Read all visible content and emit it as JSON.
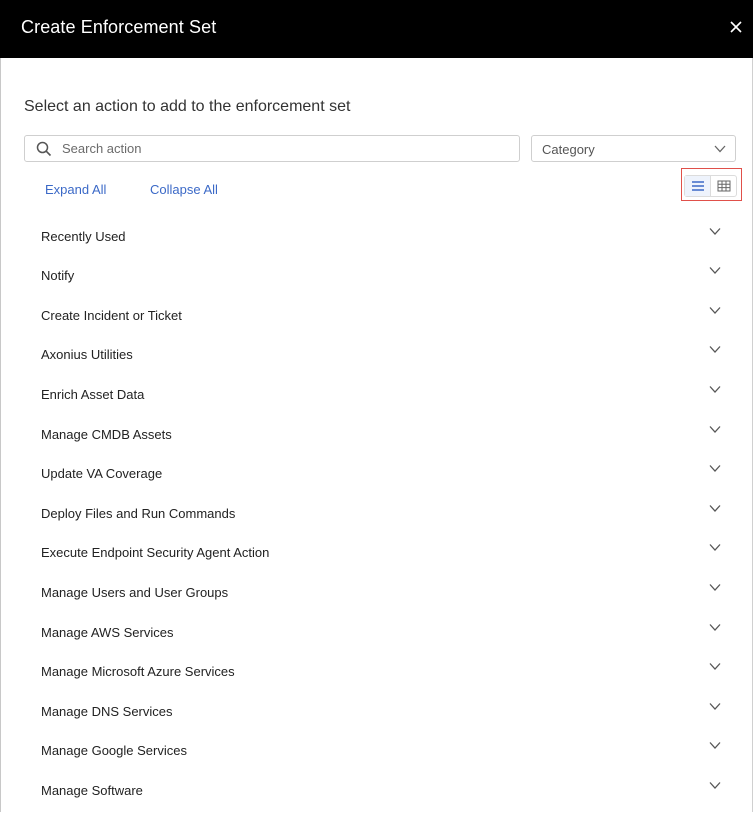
{
  "dialog": {
    "title": "Create Enforcement Set",
    "close_icon": "close-icon"
  },
  "subtitle": "Select an action to add to the enforcement set",
  "search": {
    "placeholder": "Search action",
    "value": "",
    "icon": "search-icon"
  },
  "category_select": {
    "value": "Category",
    "icon": "chevron-down-icon"
  },
  "links": {
    "expand_all": "Expand All",
    "collapse_all": "Collapse All"
  },
  "view_toggle": {
    "selected": "list",
    "options": [
      "list-view-icon",
      "grid-view-icon"
    ],
    "highlight_color": "#e0504a",
    "active_color": "#3b69c7"
  },
  "categories": [
    {
      "label": "Recently Used"
    },
    {
      "label": "Notify"
    },
    {
      "label": "Create Incident or Ticket"
    },
    {
      "label": "Axonius Utilities"
    },
    {
      "label": "Enrich Asset Data"
    },
    {
      "label": "Manage CMDB Assets"
    },
    {
      "label": "Update VA Coverage"
    },
    {
      "label": "Deploy Files and Run Commands"
    },
    {
      "label": "Execute Endpoint Security Agent Action"
    },
    {
      "label": "Manage Users and User Groups"
    },
    {
      "label": "Manage AWS Services"
    },
    {
      "label": "Manage Microsoft Azure Services"
    },
    {
      "label": "Manage DNS Services"
    },
    {
      "label": "Manage Google Services"
    },
    {
      "label": "Manage Software"
    }
  ]
}
